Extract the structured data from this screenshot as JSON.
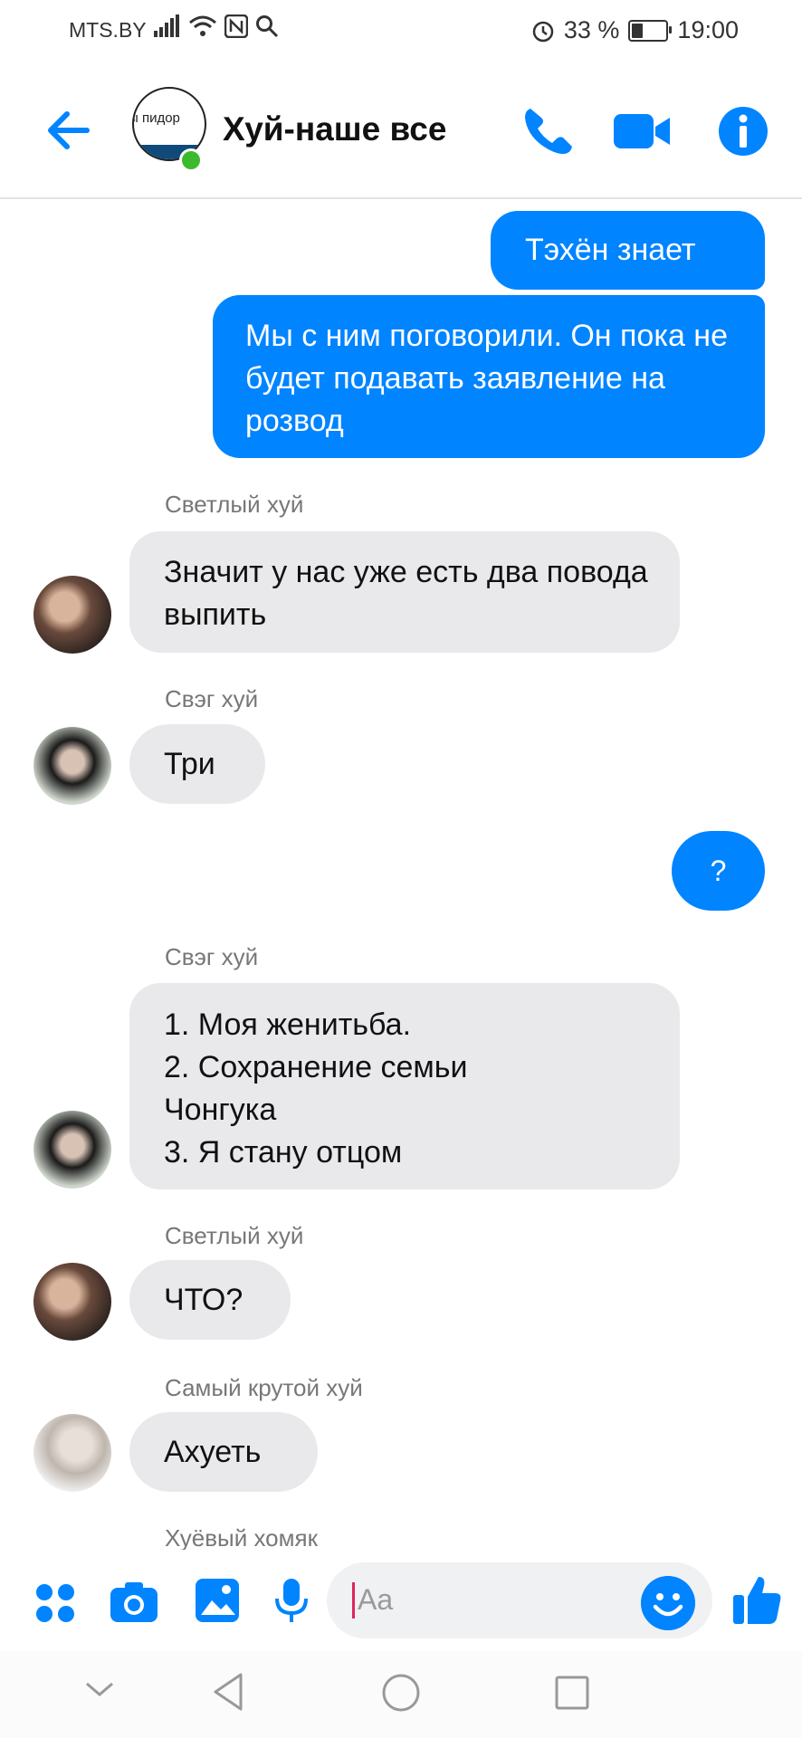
{
  "status_bar": {
    "carrier": "MTS.BY",
    "battery": "33 %",
    "battery_level": 0.33,
    "time": "19:00"
  },
  "header": {
    "title": "Хуй-наше все",
    "avatar_text": "ы пидор",
    "online": true
  },
  "messages": [
    {
      "id": "m1",
      "direction": "out",
      "text": "Тэхён знает"
    },
    {
      "id": "m2",
      "direction": "out",
      "text": "Мы с ним поговорили. Он пока не будет подавать заявление на розвод"
    },
    {
      "id": "m3",
      "direction": "in",
      "sender": "Светлый хуй",
      "text": "Значит у нас уже есть два повода выпить"
    },
    {
      "id": "m4",
      "direction": "in",
      "sender": "Свэг хуй",
      "text": "Три"
    },
    {
      "id": "m5",
      "direction": "out",
      "text": "?"
    },
    {
      "id": "m6",
      "direction": "in",
      "sender": "Свэг хуй",
      "lines": [
        "1. Моя женитьба.",
        "2. Сохранение семьи",
        "Чонгука",
        "3. Я стану отцом"
      ]
    },
    {
      "id": "m7",
      "direction": "in",
      "sender": "Светлый хуй",
      "text": "ЧТО?"
    },
    {
      "id": "m8",
      "direction": "in",
      "sender": "Самый крутой хуй",
      "text": "Ахуеть"
    },
    {
      "id": "m9",
      "direction": "in",
      "sender": "Хуёвый хомяк"
    }
  ],
  "composer": {
    "placeholder": "Aa"
  },
  "colors": {
    "accent": "#0084ff",
    "incoming_bubble": "#e9e9eb",
    "online": "#3cba2e"
  },
  "icons": {
    "header": [
      "back-arrow-icon",
      "phone-icon",
      "video-icon",
      "info-icon"
    ],
    "composer": [
      "apps-icon",
      "camera-icon",
      "gallery-icon",
      "microphone-icon",
      "emoji-icon",
      "like-icon"
    ],
    "nav": [
      "collapse-icon",
      "back-icon",
      "home-icon",
      "recents-icon"
    ]
  }
}
